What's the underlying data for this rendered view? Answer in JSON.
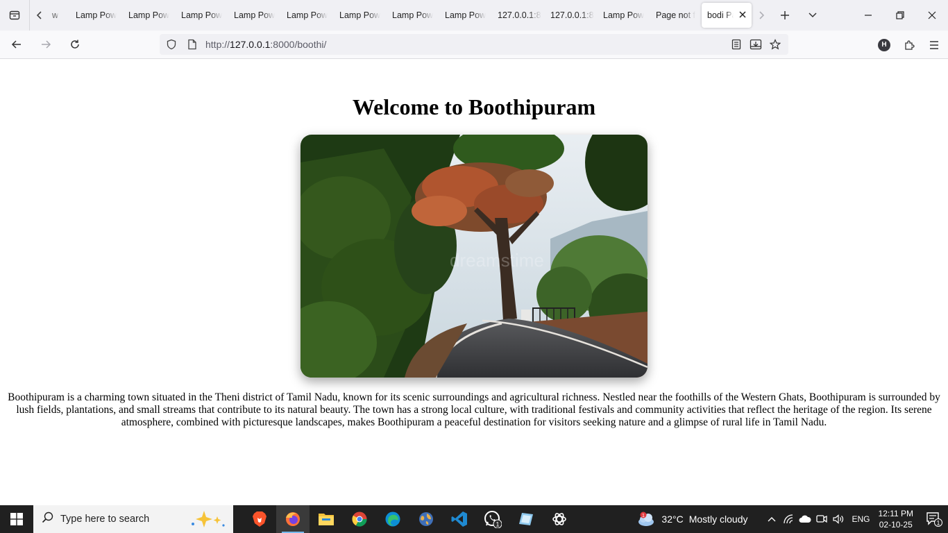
{
  "browser": {
    "tabs": [
      {
        "label": "w",
        "partial": true
      },
      {
        "label": "Lamp Pow"
      },
      {
        "label": "Lamp Pow"
      },
      {
        "label": "Lamp Pow"
      },
      {
        "label": "Lamp Pow"
      },
      {
        "label": "Lamp Pow"
      },
      {
        "label": "Lamp Pow"
      },
      {
        "label": "Lamp Pow"
      },
      {
        "label": "Lamp Pow"
      },
      {
        "label": "127.0.0.1:8"
      },
      {
        "label": "127.0.0.1:8"
      },
      {
        "label": "Lamp Pow"
      },
      {
        "label": "Page not f"
      },
      {
        "label": "bodi Pa",
        "active": true
      }
    ],
    "url": {
      "prefix": "http://",
      "host": "127.0.0.1",
      "rest": ":8000/boothi/"
    },
    "profile_initial": "H"
  },
  "page": {
    "heading": "Welcome to Boothipuram",
    "image_watermark": "dreamstime",
    "description": "Boothipuram is a charming town situated in the Theni district of Tamil Nadu, known for its scenic surroundings and agricultural richness. Nestled near the foothills of the Western Ghats, Boothipuram is surrounded by lush fields, plantations, and small streams that contribute to its natural beauty. The town has a strong local culture, with traditional festivals and community activities that reflect the heritage of the region. Its serene atmosphere, combined with picturesque landscapes, makes Boothipuram a peaceful destination for visitors seeking nature and a glimpse of rural life in Tamil Nadu."
  },
  "taskbar": {
    "search_placeholder": "Type here to search",
    "apps": [
      "brave-icon",
      "firefox-icon",
      "file-explorer-icon",
      "chrome-icon",
      "edge-icon",
      "network-globe-icon",
      "vscode-icon",
      "whatsapp-icon",
      "notes-app-icon",
      "chatgpt-icon"
    ],
    "whatsapp_badge": "1",
    "weather_badge": "1",
    "weather_temp": "32°C",
    "weather_desc": "Mostly cloudy",
    "language": "ENG",
    "time": "12:11 PM",
    "date": "02-10-25",
    "notification_count": "1"
  }
}
